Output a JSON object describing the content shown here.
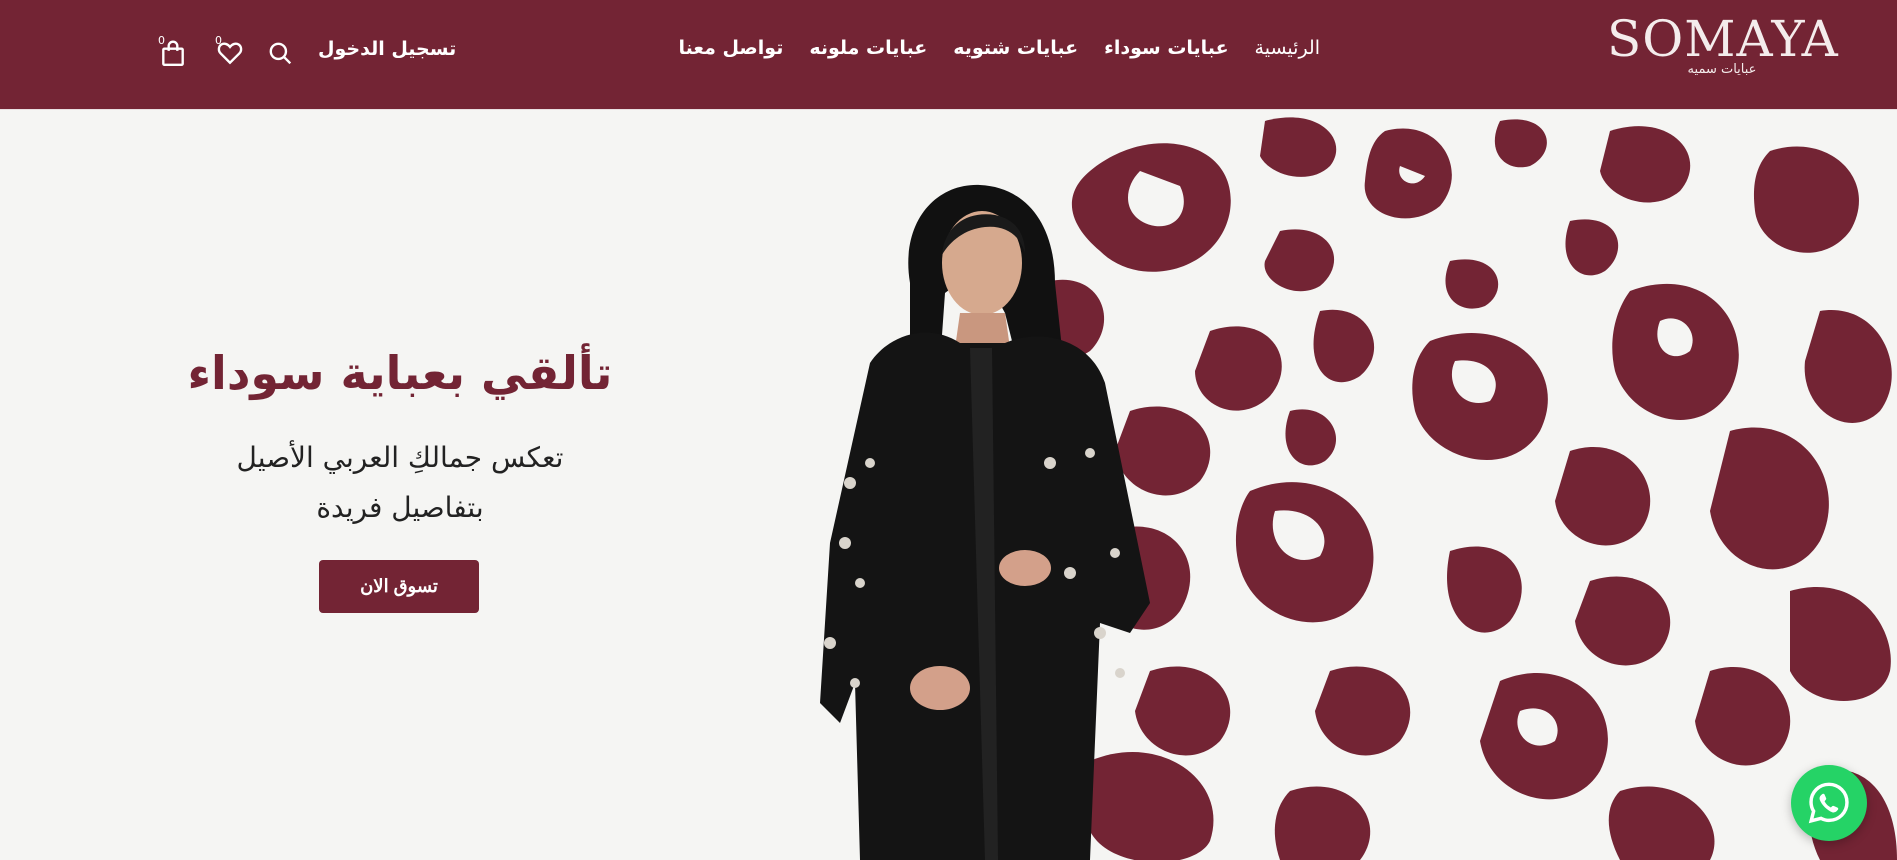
{
  "brand": {
    "name": "SOMAYA",
    "tagline": "عبايات سميه",
    "color": "#732434"
  },
  "nav": {
    "items": [
      {
        "label": "الرئيسية",
        "active": true
      },
      {
        "label": "عبايات سوداء"
      },
      {
        "label": "عبايات شتويه"
      },
      {
        "label": "عبايات ملونه"
      },
      {
        "label": "تواصل معنا"
      }
    ]
  },
  "header_actions": {
    "login_label": "تسجيل الدخول",
    "search_icon": "search-icon",
    "wishlist_count": "0",
    "cart_count": "0"
  },
  "hero": {
    "title": "تألقي بعباية سوداء",
    "subtitle_line1": "تعكس جمالكِ العربي الأصيل",
    "subtitle_line2": "بتفاصيل فريدة",
    "cta_label": "تسوق الان"
  },
  "floating": {
    "whatsapp_icon": "whatsapp-icon",
    "whatsapp_color": "#25d366"
  }
}
